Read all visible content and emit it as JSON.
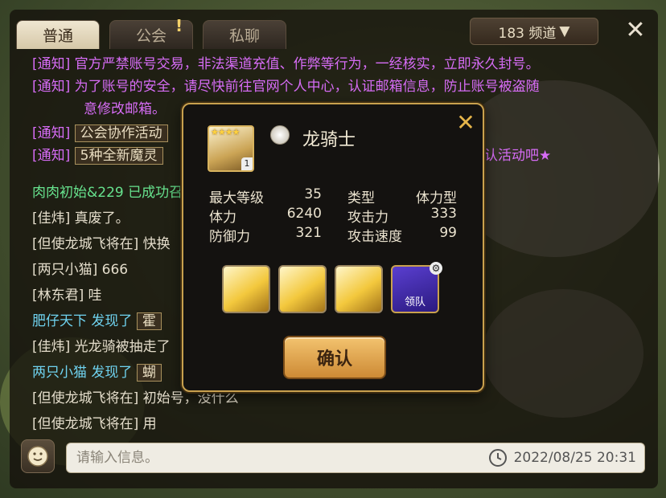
{
  "tabs": [
    {
      "label": "普通",
      "active": true
    },
    {
      "label": "公会",
      "active": false
    },
    {
      "label": "私聊",
      "active": false
    }
  ],
  "channel": {
    "label": "183 频道",
    "arrow": "▼"
  },
  "messages": [
    {
      "tag": "[通知]",
      "text": "官方严禁账号交易，非法渠道充值、作弊等行为，一经核实，立即永久封号。",
      "style": "notice"
    },
    {
      "tag": "[通知]",
      "text": "为了账号的安全，请尽快前往官网个人中心，认证邮箱信息，防止账号被盗随",
      "style": "notice"
    },
    {
      "tag": "",
      "text": "意修改邮箱。",
      "style": "notice"
    },
    {
      "tag": "[通知]",
      "text": "公会协作活动",
      "style": "notice-badge"
    },
    {
      "tag": "[通知]",
      "text": "5种全新魔灵",
      "tail": "认活动吧★",
      "style": "notice-badge"
    },
    {
      "text": "肉肉初始&229 已成功召",
      "style": "green"
    },
    {
      "name": "[佳炜]",
      "text": " 真废了。"
    },
    {
      "name": "[但使龙城飞将在]",
      "text": " 快换"
    },
    {
      "name": "[两只小猫]",
      "text": " 666"
    },
    {
      "name": "[林东君]",
      "text": " 哇"
    },
    {
      "name": "肥仔天下",
      "text": " 发现了",
      "badge": "霍",
      "style": "cyan"
    },
    {
      "name": "[佳炜]",
      "text": " 光龙骑被抽走了"
    },
    {
      "name": "两只小猫",
      "text": " 发现了",
      "badge": "蝴",
      "style": "cyan"
    },
    {
      "name": "[但使龙城飞将在]",
      "text": " 初始号，没什么"
    },
    {
      "name": "[但使龙城飞将在]",
      "text": " 用"
    }
  ],
  "input": {
    "placeholder": "请输入信息。",
    "timestamp": "2022/08/25  20:31"
  },
  "modal": {
    "name": "龙骑士",
    "star_count": 4,
    "level_badge": "1",
    "stats": [
      {
        "label": "最大等级",
        "value": "35",
        "label2": "类型",
        "value2": "体力型"
      },
      {
        "label": "体力",
        "value": "6240",
        "label2": "攻击力",
        "value2": "333"
      },
      {
        "label": "防御力",
        "value": "321",
        "label2": "攻击速度",
        "value2": "99"
      }
    ],
    "skills": [
      "skill-1-icon",
      "skill-2-icon",
      "skill-3-icon",
      "leader-skill-icon"
    ],
    "leader_label": "领队",
    "confirm_label": "确认"
  }
}
